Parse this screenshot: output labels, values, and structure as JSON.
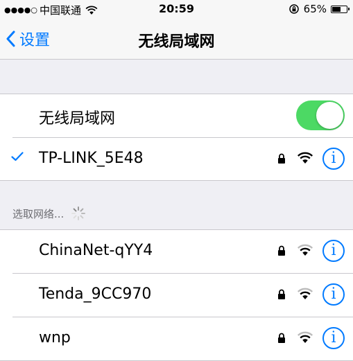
{
  "status_bar": {
    "signal_dots": "●●●●○",
    "carrier": "中国联通",
    "time": "20:59",
    "battery_percent": "65%",
    "battery_level": 0.65
  },
  "nav": {
    "back_label": "设置",
    "title": "无线局域网"
  },
  "wlan_toggle": {
    "label": "无线局域网",
    "on": true,
    "accent": "#4cd964"
  },
  "connected_network": {
    "name": "TP-LINK_5E48",
    "checked": true
  },
  "section": {
    "header": "选取网络..."
  },
  "networks": [
    {
      "name": "ChinaNet-qYY4"
    },
    {
      "name": "Tenda_9CC970"
    },
    {
      "name": "wnp"
    }
  ],
  "colors": {
    "tint": "#007aff",
    "background": "#efeff4"
  }
}
